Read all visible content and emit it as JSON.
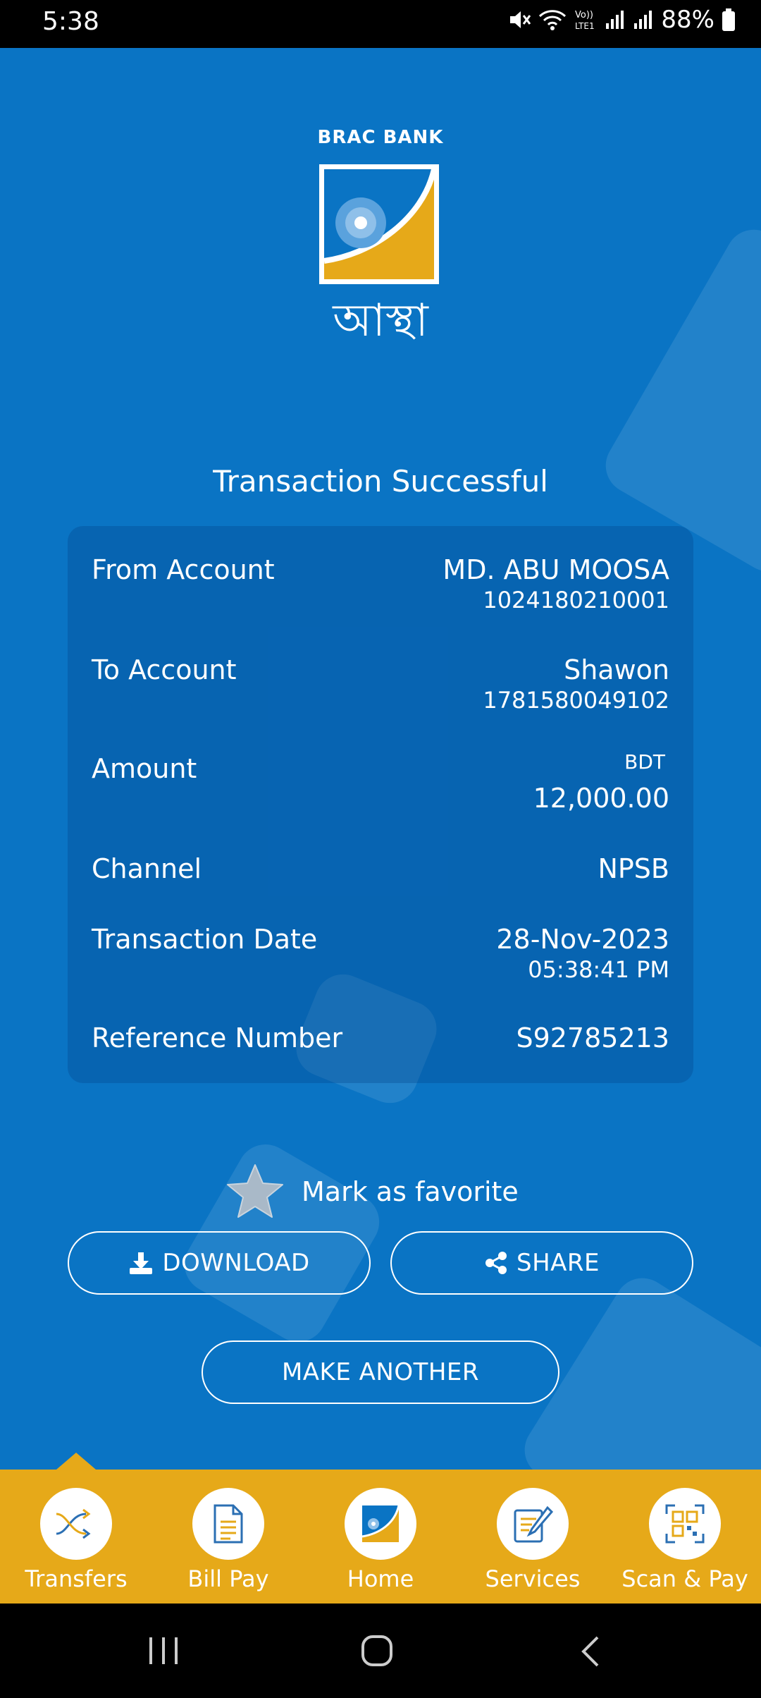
{
  "status_bar": {
    "time": "5:38",
    "battery": "88%"
  },
  "brand": {
    "bank_name": "BRAC BANK",
    "app_name": "আস্থা"
  },
  "title": "Transaction Successful",
  "details": {
    "from_label": "From Account",
    "from_name": "MD. ABU MOOSA",
    "from_number": "1024180210001",
    "to_label": "To Account",
    "to_name": "Shawon",
    "to_number": "1781580049102",
    "amount_label": "Amount",
    "currency": "BDT",
    "amount": "12,000.00",
    "channel_label": "Channel",
    "channel": "NPSB",
    "date_label": "Transaction Date",
    "date": "28-Nov-2023",
    "time": "05:38:41 PM",
    "ref_label": "Reference Number",
    "ref": "S92785213"
  },
  "favorite": {
    "label": "Mark as favorite"
  },
  "buttons": {
    "download": "DOWNLOAD",
    "share": "SHARE",
    "make_another": "MAKE ANOTHER"
  },
  "bottom_nav": {
    "transfers": "Transfers",
    "bill_pay": "Bill Pay",
    "home": "Home",
    "services": "Services",
    "scan_pay": "Scan & Pay"
  },
  "colors": {
    "background": "#0a74c4",
    "accent": "#e6a919"
  }
}
